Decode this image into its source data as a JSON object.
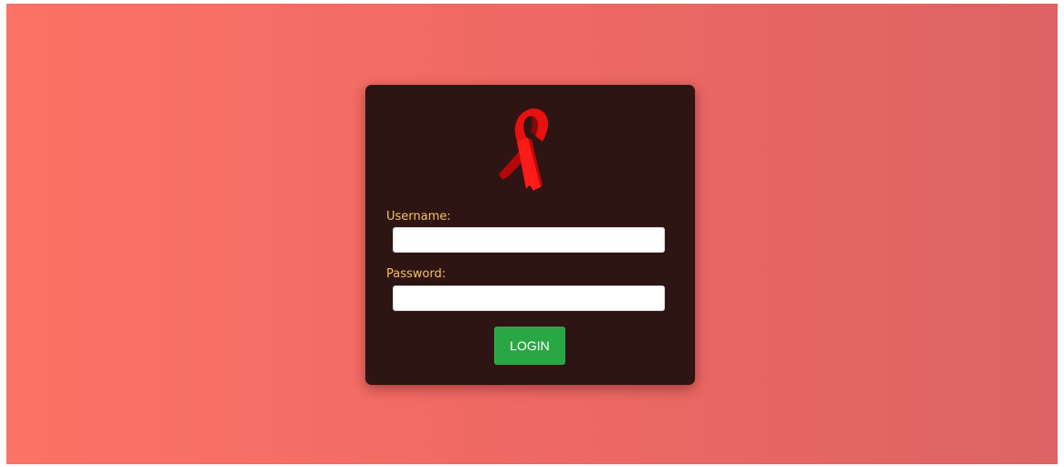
{
  "form": {
    "username_label": "Username:",
    "username_value": "",
    "password_label": "Password:",
    "password_value": "",
    "login_label": "LOGIN"
  },
  "logo": {
    "icon": "red-awareness-ribbon-icon"
  },
  "colors": {
    "background_left": "#fd7266",
    "background_right": "#dd6364",
    "card": "#2f1414",
    "label": "#f3c25f",
    "button": "#2aa745",
    "ribbon": "#e60c0c"
  }
}
